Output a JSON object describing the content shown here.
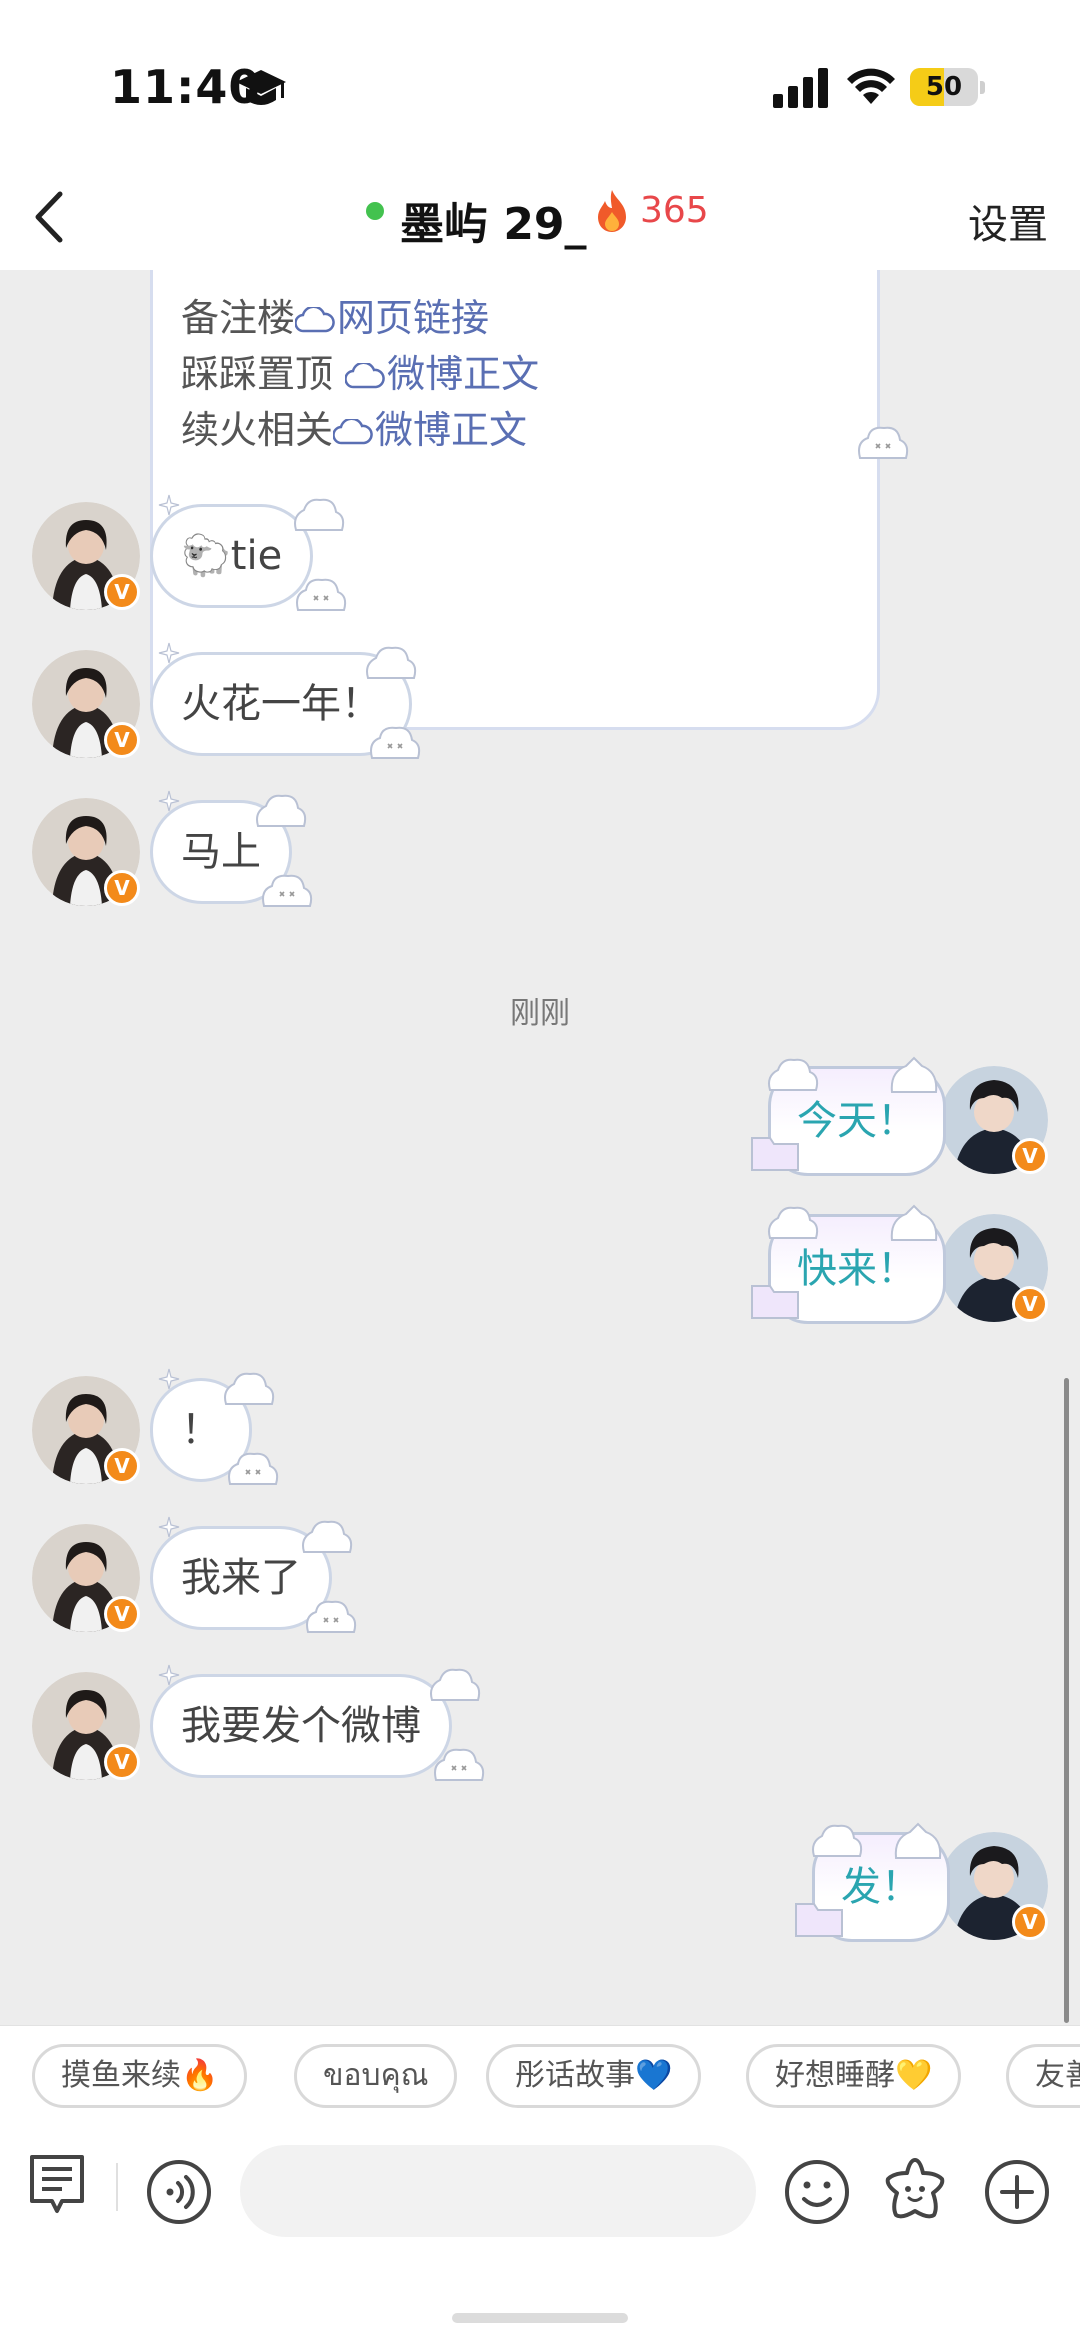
{
  "status_bar": {
    "time": "11:40",
    "battery": "50"
  },
  "header": {
    "back_icon": "chevron-left-icon",
    "name": "墨屿 29_",
    "fire_count": "365",
    "settings_label": "设置"
  },
  "card": {
    "lines": [
      {
        "label": "备注楼",
        "link": "网页链接"
      },
      {
        "label": "踩踩置顶 ",
        "link": "微博正文"
      },
      {
        "label": "续火相关",
        "link": "微博正文"
      }
    ]
  },
  "messages": [
    {
      "side": "left",
      "text": "🐑tie"
    },
    {
      "side": "left",
      "text": "火花一年！"
    },
    {
      "side": "left",
      "text": "马上"
    },
    {
      "side": "right",
      "text": "今天！"
    },
    {
      "side": "right",
      "text": "快来！"
    },
    {
      "side": "left",
      "text": "！"
    },
    {
      "side": "left",
      "text": "我来了"
    },
    {
      "side": "left",
      "text": "我要发个微博"
    },
    {
      "side": "right",
      "text": "发！"
    }
  ],
  "timestamp": "刚刚",
  "quick_replies": [
    "摸鱼来续🔥",
    "ขอบคุณ",
    "彤话故事💙",
    "好想睡酵💛",
    "友善"
  ],
  "input": {
    "placeholder": ""
  },
  "colors": {
    "fire": "#e8474a",
    "online": "#43c24f",
    "verified": "#f38a1a",
    "right_text": "#2aa5b0"
  }
}
